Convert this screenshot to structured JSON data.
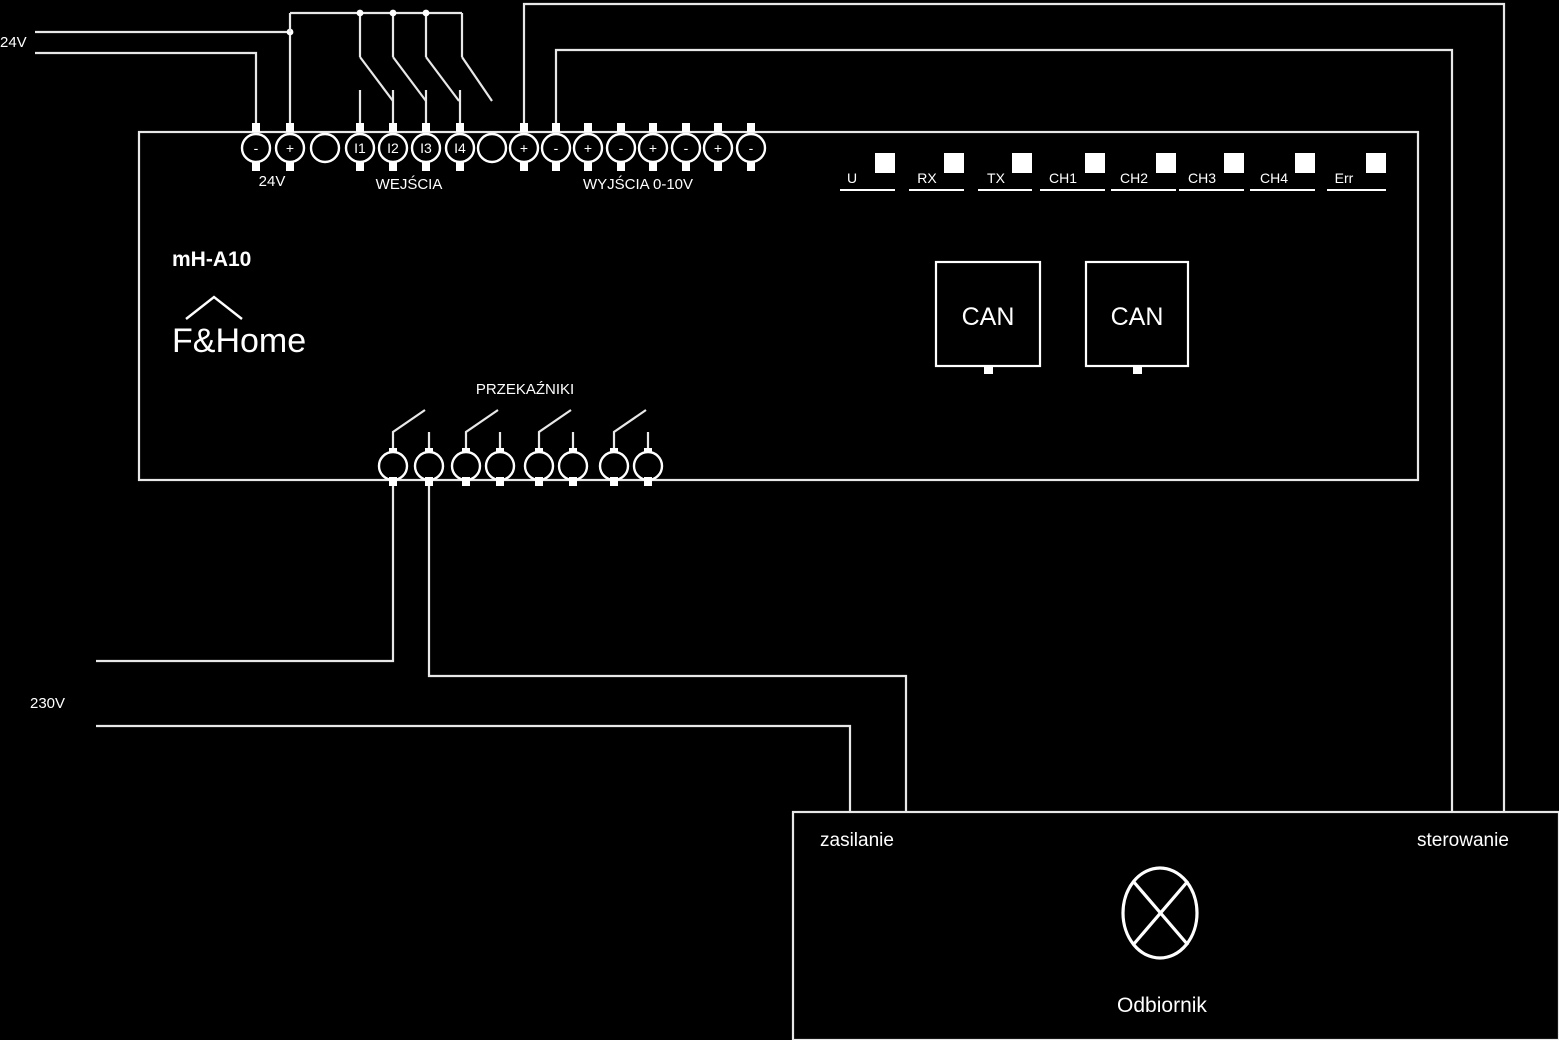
{
  "diagram": {
    "title": "mH-A10 wiring diagram",
    "background": "#000000",
    "stroke": "#e8e8e8"
  },
  "device": {
    "model_label": "mH-A10",
    "brand_label": "F&Home",
    "brand_icon": "roof-chevron-icon",
    "sections": {
      "power": "24V",
      "inputs": "WEJŚCIA",
      "analog_outputs": "WYJŚCIA 0-10V",
      "relays": "PRZEKAŹNIKI"
    },
    "terminals_top": [
      {
        "label": "-",
        "kind": "minus"
      },
      {
        "label": "+",
        "kind": "plus"
      },
      {
        "label": "",
        "kind": "blank"
      },
      {
        "label": "I1",
        "kind": "input"
      },
      {
        "label": "I2",
        "kind": "input"
      },
      {
        "label": "I3",
        "kind": "input"
      },
      {
        "label": "I4",
        "kind": "input"
      },
      {
        "label": "",
        "kind": "blank"
      },
      {
        "label": "+",
        "kind": "plus"
      },
      {
        "label": "-",
        "kind": "minus"
      },
      {
        "label": "+",
        "kind": "plus"
      },
      {
        "label": "-",
        "kind": "minus"
      },
      {
        "label": "+",
        "kind": "plus"
      },
      {
        "label": "-",
        "kind": "minus"
      },
      {
        "label": "+",
        "kind": "plus"
      },
      {
        "label": "-",
        "kind": "minus"
      }
    ],
    "leds": [
      {
        "label": "U"
      },
      {
        "label": "RX"
      },
      {
        "label": "TX"
      },
      {
        "label": "CH1"
      },
      {
        "label": "CH2"
      },
      {
        "label": "CH3"
      },
      {
        "label": "CH4"
      },
      {
        "label": "Err"
      }
    ],
    "can_ports": [
      {
        "label": "CAN"
      },
      {
        "label": "CAN"
      }
    ],
    "relay_count": 4,
    "relay_terminal_count": 8
  },
  "rails": {
    "supply_24v": "24V",
    "supply_230v": "230V"
  },
  "load": {
    "name": "Odbiornik",
    "power_label": "zasilanie",
    "control_label": "sterowanie",
    "symbol": "lamp-cross-icon"
  }
}
